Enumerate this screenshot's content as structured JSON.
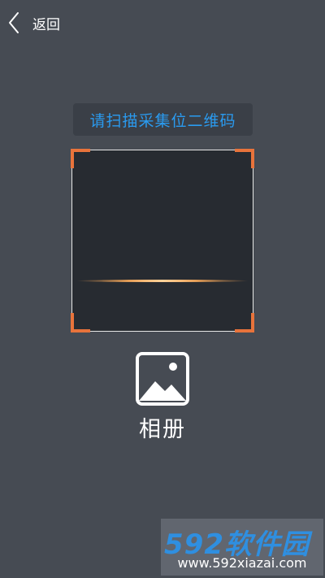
{
  "header": {
    "back_label": "返回",
    "back_icon": "chevron-left-icon"
  },
  "scanner": {
    "prompt": "请扫描采集位二维码",
    "prompt_color": "#2a9bf0",
    "corner_color": "#e8733b"
  },
  "album": {
    "label": "相册",
    "icon": "image-icon"
  },
  "watermark": {
    "brand": "592软件园",
    "url": "www.592xiazai.com"
  }
}
